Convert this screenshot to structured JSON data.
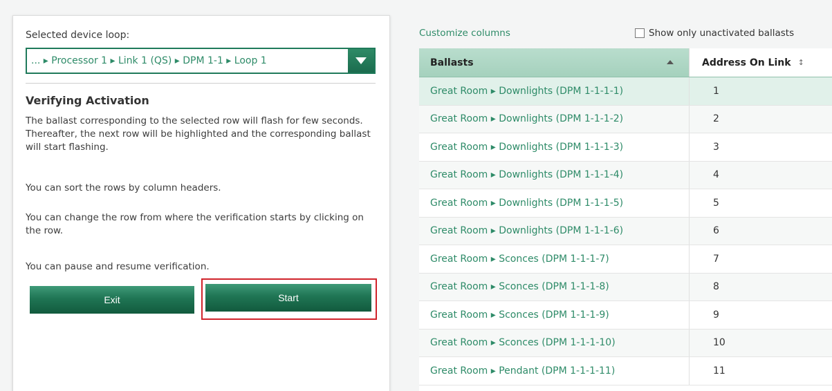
{
  "left": {
    "loop_label": "Selected device loop:",
    "loop_path": "... ▸ Processor 1 ▸ Link 1 (QS) ▸ DPM 1-1 ▸ Loop 1",
    "title": "Verifying Activation",
    "para1": "The ballast corresponding to the selected row will flash for few seconds. Thereafter, the next row will be highlighted and the corresponding ballast will start flashing.",
    "para2": "You can sort the rows by column headers.",
    "para3": "You can change the row from where the verification starts by clicking on the row.",
    "para4": "You can pause and resume verification.",
    "exit_label": "Exit",
    "start_label": "Start"
  },
  "right": {
    "customize_label": "Customize columns",
    "show_only_label": "Show only unactivated ballasts",
    "columns": [
      "Ballasts",
      "Address On Link"
    ],
    "rows": [
      {
        "ballast": "Great Room ▸ Downlights (DPM 1-1-1-1)",
        "address": "1"
      },
      {
        "ballast": "Great Room ▸ Downlights (DPM 1-1-1-2)",
        "address": "2"
      },
      {
        "ballast": "Great Room ▸ Downlights (DPM 1-1-1-3)",
        "address": "3"
      },
      {
        "ballast": "Great Room ▸ Downlights (DPM 1-1-1-4)",
        "address": "4"
      },
      {
        "ballast": "Great Room ▸ Downlights (DPM 1-1-1-5)",
        "address": "5"
      },
      {
        "ballast": "Great Room ▸ Downlights (DPM 1-1-1-6)",
        "address": "6"
      },
      {
        "ballast": "Great Room ▸ Sconces (DPM 1-1-1-7)",
        "address": "7"
      },
      {
        "ballast": "Great Room ▸ Sconces (DPM 1-1-1-8)",
        "address": "8"
      },
      {
        "ballast": "Great Room ▸ Sconces (DPM 1-1-1-9)",
        "address": "9"
      },
      {
        "ballast": "Great Room ▸ Sconces (DPM 1-1-1-10)",
        "address": "10"
      },
      {
        "ballast": "Great Room ▸ Pendant (DPM 1-1-1-11)",
        "address": "11"
      }
    ]
  },
  "colors": {
    "accent_green": "#2e8b68",
    "header_green": "#b9ddcd",
    "highlight_red": "#d0232a"
  }
}
